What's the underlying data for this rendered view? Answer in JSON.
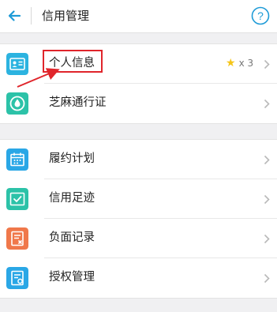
{
  "header": {
    "title": "信用管理",
    "back_icon": "back-arrow-icon",
    "help_icon": "question-circle-icon"
  },
  "groups": [
    [
      {
        "label": "个人信息",
        "icon": "id-card-icon",
        "badge_count": "x 3"
      },
      {
        "label": "芝麻通行证",
        "icon": "drop-badge-icon"
      }
    ],
    [
      {
        "label": "履约计划",
        "icon": "calendar-icon"
      },
      {
        "label": "信用足迹",
        "icon": "inbox-check-icon"
      },
      {
        "label": "负面记录",
        "icon": "document-x-icon"
      },
      {
        "label": "授权管理",
        "icon": "document-settings-icon"
      }
    ]
  ],
  "colors": {
    "accent": "#1e9bd7",
    "teal": "#2cc2a8",
    "orange": "#f0784a",
    "highlight": "#e0252b",
    "star": "#f5c518"
  }
}
